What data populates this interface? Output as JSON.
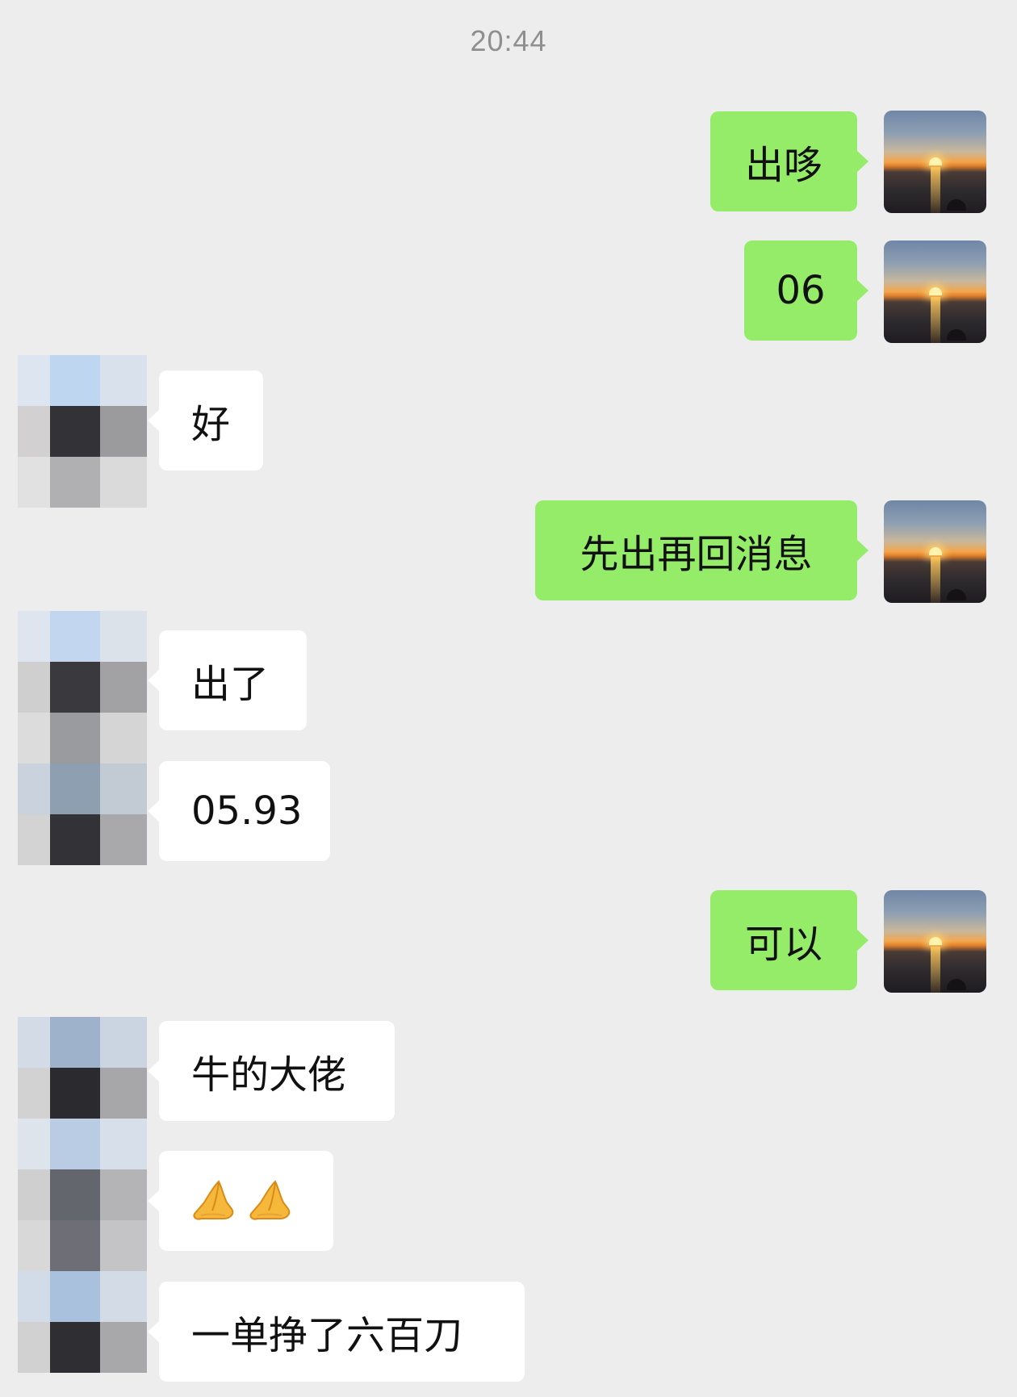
{
  "chat": {
    "timestamp": "20:44",
    "messages": [
      {
        "direction": "out",
        "text": "出哆"
      },
      {
        "direction": "out",
        "text": "06"
      },
      {
        "direction": "in",
        "text": "好"
      },
      {
        "direction": "out",
        "text": "先出再回消息"
      },
      {
        "direction": "in",
        "text": "出了"
      },
      {
        "direction": "in",
        "text": "05.93"
      },
      {
        "direction": "out",
        "text": "可以"
      },
      {
        "direction": "in",
        "text": "牛的大佬"
      },
      {
        "direction": "in",
        "text": "🙏🙏",
        "icon": "praying-hands-icon"
      },
      {
        "direction": "in",
        "text": "一单挣了六百刀"
      }
    ]
  },
  "colors": {
    "background": "#ededed",
    "outgoing_bubble": "#95ec69",
    "incoming_bubble": "#ffffff",
    "timestamp_text": "#8f8f8f"
  },
  "icons": {
    "self_avatar": "sunset-avatar-icon",
    "contact_avatar": "pixelated-avatar-icon",
    "hands": "praying-hands-icon"
  }
}
